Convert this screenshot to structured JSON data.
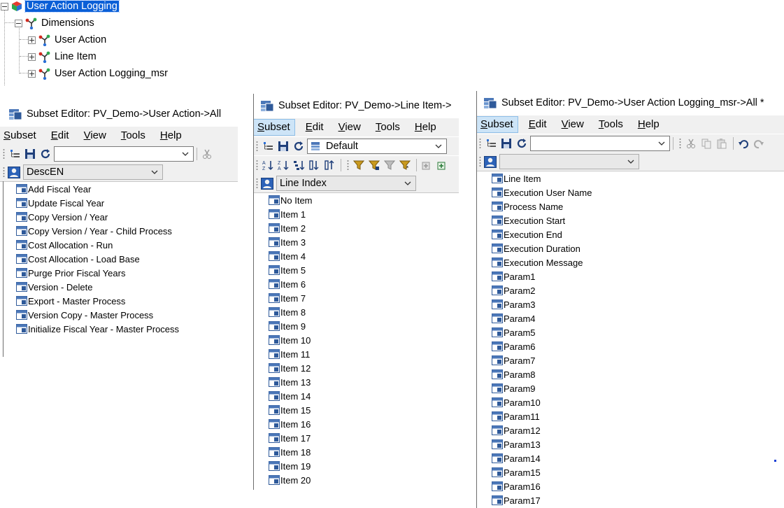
{
  "tree": {
    "root": "User Action Logging",
    "folder": "Dimensions",
    "dims": [
      "User Action",
      "Line Item",
      "User Action Logging_msr"
    ]
  },
  "editors": [
    {
      "title": "Subset Editor:  PV_Demo->User Action->All",
      "menus": [
        "Subset",
        "Edit",
        "View",
        "Tools",
        "Help"
      ],
      "subset_combo": "",
      "alias_combo": "DescEN",
      "items": [
        "Add Fiscal Year",
        "Update Fiscal Year",
        "Copy Version / Year",
        "Copy Version / Year - Child Process",
        "Cost Allocation - Run",
        "Cost Allocation - Load Base",
        "Purge Prior Fiscal Years",
        "Version - Delete",
        "Export - Master Process",
        "Version Copy - Master Process",
        "Initialize Fiscal Year - Master Process"
      ]
    },
    {
      "title": "Subset Editor:  PV_Demo->Line Item->",
      "menus": [
        "Subset",
        "Edit",
        "View",
        "Tools",
        "Help"
      ],
      "subset_combo": "Default",
      "alias_combo": "Line Index",
      "items": [
        "No Item",
        "Item 1",
        "Item 2",
        "Item 3",
        "Item 4",
        "Item 5",
        "Item 6",
        "Item 7",
        "Item 8",
        "Item 9",
        "Item 10",
        "Item 11",
        "Item 12",
        "Item 13",
        "Item 14",
        "Item 15",
        "Item 16",
        "Item 17",
        "Item 18",
        "Item 19",
        "Item 20"
      ]
    },
    {
      "title": "Subset Editor:  PV_Demo->User Action Logging_msr->All  *",
      "menus": [
        "Subset",
        "Edit",
        "View",
        "Tools",
        "Help"
      ],
      "subset_combo": "",
      "alias_combo": "",
      "items": [
        "Line Item",
        "Execution User Name",
        "Process Name",
        "Execution Start",
        "Execution End",
        "Execution Duration",
        "Execution Message",
        "Param1",
        "Param2",
        "Param3",
        "Param4",
        "Param5",
        "Param6",
        "Param7",
        "Param8",
        "Param9",
        "Param10",
        "Param11",
        "Param12",
        "Param13",
        "Param14",
        "Param15",
        "Param16",
        "Param17"
      ]
    }
  ],
  "icons": {
    "cube": "cube-icon",
    "dimension": "dimension-icon",
    "element": "element-icon",
    "subset_window": "subset-editor-icon"
  },
  "colors": {
    "selection": "#0a5fd7",
    "active_menu": "#cde4f7",
    "toolbar_bg": "#f0f0f0"
  }
}
